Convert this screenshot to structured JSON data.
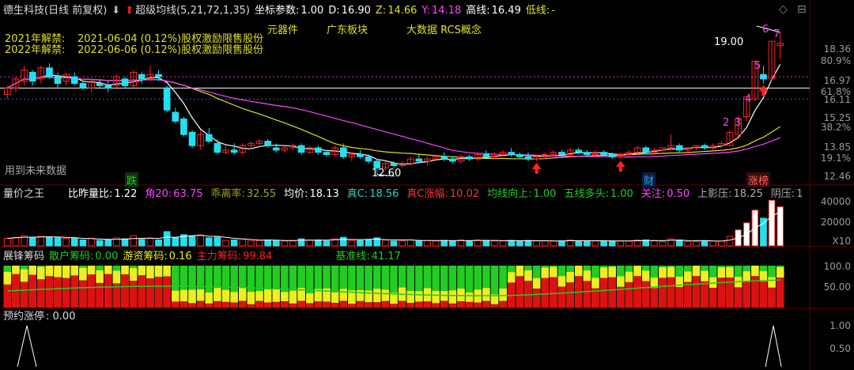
{
  "main": {
    "stock_name": "德生科技(日线 前复权)",
    "indicator": "超级均线(5,21,72,1,35)",
    "coord_label": "坐标参数:",
    "coord_value": "1.00",
    "d_label": "D:",
    "d_value": "16.90",
    "z_label": "Z:",
    "z_value": "14.66",
    "y_label": "Y:",
    "y_value": "14.18",
    "high_label": "高线:",
    "high_value": "16.49",
    "low_label": "低线:",
    "low_value": "-",
    "unlock_2021": "2021年解禁:",
    "unlock_2021_detail": "2021-06-04 (0.12%)股权激励限售股份",
    "unlock_2022": "2022年解禁:",
    "unlock_2022_detail": "2022-06-06 (0.12%)股权激励限售股份",
    "concepts": [
      "元器件",
      "广东板块",
      "大数据 RCS概念"
    ],
    "future_data": "用到未来数据",
    "fall_tag": "跌",
    "finance_tag": "财",
    "limit_tag": "涨榜",
    "high_annot": "19.00",
    "low_annot": "12.60",
    "boards": [
      "2",
      "3",
      "4",
      "5",
      "6",
      "7"
    ],
    "axis": [
      "18.36",
      "80.9%",
      "16.97",
      "61.8%",
      "16.11",
      "15.25",
      "38.2%",
      "13.85",
      "19.1%",
      "12.46"
    ]
  },
  "vol": {
    "title": "量价之王",
    "items": [
      {
        "label": "比昨量比:",
        "value": "1.22",
        "color": "#ffffff"
      },
      {
        "label": "角20:",
        "value": "63.75",
        "color": "#ff44ff"
      },
      {
        "label": "乖离率:",
        "value": "32.55",
        "color": "#a0a020"
      },
      {
        "label": "均价:",
        "value": "18.13",
        "color": "#ffffff"
      },
      {
        "label": "真C:",
        "value": "18.56",
        "color": "#33cccc"
      },
      {
        "label": "真C涨幅:",
        "value": "10.02",
        "color": "#ff3333"
      },
      {
        "label": "均线向上:",
        "value": "1.00",
        "color": "#22cc22"
      },
      {
        "label": "五线多头:",
        "value": "1.00",
        "color": "#22cc22"
      },
      {
        "label": "关注:",
        "value": "0.50",
        "color": "#ff44ff"
      },
      {
        "label": "上影压:",
        "value": "18.25",
        "color": "#aaaaaa"
      },
      {
        "label": "阴压:",
        "value": "1",
        "color": "#aaaaaa"
      }
    ],
    "axis": [
      "40000",
      "20000",
      "X10"
    ]
  },
  "chips": {
    "title": "展锋筹码",
    "retail_label": "散户筹码:",
    "retail_value": "0.00",
    "hot_label": "游资筹码:",
    "hot_value": "0.16",
    "main_label": "主力筹码:",
    "main_value": "99.84",
    "base_label": "基准线:",
    "base_value": "41.17",
    "axis": [
      "100.0",
      "50.00"
    ]
  },
  "limit": {
    "title": "预约涨停",
    "value": ": 0.00",
    "axis": [
      "1.00",
      "0.50"
    ]
  },
  "colors": {
    "up": "#ff2222",
    "down": "#22e0f0",
    "ma1": "#ffffff",
    "ma2": "#e0e020",
    "ma3": "#ff44ff",
    "retail": "#22cc22",
    "hot": "#eeee22",
    "main": "#dd1111"
  },
  "chart_data": {
    "type": "candlestick",
    "bars": 93,
    "ohlc": [
      [
        16.2,
        16.6,
        16.0,
        16.5
      ],
      [
        16.5,
        17.0,
        16.3,
        16.9
      ],
      [
        16.8,
        17.5,
        16.6,
        17.3
      ],
      [
        17.2,
        17.3,
        16.6,
        16.8
      ],
      [
        16.9,
        17.5,
        16.7,
        17.4
      ],
      [
        17.4,
        17.6,
        16.9,
        17.0
      ],
      [
        17.0,
        17.2,
        16.5,
        16.7
      ],
      [
        16.8,
        17.2,
        16.6,
        17.1
      ],
      [
        17.0,
        17.2,
        16.6,
        16.7
      ],
      [
        16.7,
        16.8,
        16.4,
        16.5
      ],
      [
        16.5,
        16.9,
        16.3,
        16.8
      ],
      [
        16.7,
        16.9,
        16.5,
        16.6
      ],
      [
        16.6,
        16.8,
        16.3,
        16.5
      ],
      [
        16.6,
        17.1,
        16.5,
        17.0
      ],
      [
        16.9,
        17.0,
        16.5,
        16.6
      ],
      [
        16.6,
        17.3,
        16.5,
        17.2
      ],
      [
        17.1,
        17.2,
        16.7,
        16.9
      ],
      [
        16.9,
        17.5,
        16.8,
        17.1
      ],
      [
        17.1,
        17.3,
        16.8,
        17.0
      ],
      [
        16.5,
        16.6,
        15.4,
        15.5
      ],
      [
        15.4,
        15.6,
        14.9,
        15.0
      ],
      [
        15.1,
        15.2,
        14.3,
        14.4
      ],
      [
        14.5,
        14.6,
        13.8,
        13.9
      ],
      [
        13.9,
        14.6,
        13.7,
        14.4
      ],
      [
        14.4,
        14.7,
        14.0,
        14.1
      ],
      [
        14.0,
        14.2,
        13.5,
        13.6
      ],
      [
        13.6,
        13.9,
        13.5,
        13.7
      ],
      [
        13.7,
        14.0,
        13.5,
        13.6
      ],
      [
        13.6,
        14.0,
        13.5,
        13.9
      ],
      [
        13.9,
        14.1,
        13.8,
        14.0
      ],
      [
        14.0,
        14.2,
        13.8,
        14.1
      ],
      [
        14.1,
        14.2,
        13.8,
        13.9
      ],
      [
        13.8,
        14.0,
        13.6,
        13.7
      ],
      [
        13.7,
        13.9,
        13.6,
        13.8
      ],
      [
        13.8,
        14.0,
        13.7,
        13.9
      ],
      [
        13.9,
        14.0,
        13.5,
        13.6
      ],
      [
        13.6,
        13.9,
        13.5,
        13.8
      ],
      [
        13.8,
        13.9,
        13.5,
        13.6
      ],
      [
        13.6,
        13.7,
        13.4,
        13.5
      ],
      [
        13.5,
        13.9,
        13.4,
        13.8
      ],
      [
        13.8,
        14.0,
        13.3,
        13.4
      ],
      [
        13.4,
        13.6,
        13.2,
        13.5
      ],
      [
        13.5,
        13.7,
        13.3,
        13.4
      ],
      [
        13.4,
        13.5,
        13.1,
        13.2
      ],
      [
        13.2,
        13.3,
        12.6,
        12.9
      ],
      [
        12.9,
        13.2,
        12.8,
        13.1
      ],
      [
        13.1,
        13.2,
        12.9,
        13.0
      ],
      [
        13.0,
        13.2,
        12.9,
        13.1
      ],
      [
        13.1,
        13.4,
        13.0,
        13.3
      ],
      [
        13.3,
        13.5,
        13.1,
        13.2
      ],
      [
        13.2,
        13.4,
        13.0,
        13.3
      ],
      [
        13.3,
        13.5,
        13.2,
        13.4
      ],
      [
        13.4,
        13.6,
        13.2,
        13.3
      ],
      [
        13.3,
        13.4,
        13.1,
        13.2
      ],
      [
        13.2,
        13.5,
        13.1,
        13.4
      ],
      [
        13.4,
        13.5,
        13.2,
        13.3
      ],
      [
        13.3,
        13.6,
        13.2,
        13.5
      ],
      [
        13.5,
        13.7,
        13.3,
        13.4
      ],
      [
        13.4,
        13.6,
        13.3,
        13.5
      ],
      [
        13.5,
        13.7,
        13.4,
        13.6
      ],
      [
        13.6,
        13.8,
        13.4,
        13.5
      ],
      [
        13.5,
        13.6,
        13.3,
        13.4
      ],
      [
        13.4,
        13.6,
        13.2,
        13.3
      ],
      [
        13.3,
        13.5,
        13.2,
        13.4
      ],
      [
        13.4,
        13.6,
        13.3,
        13.5
      ],
      [
        13.5,
        13.7,
        13.4,
        13.6
      ],
      [
        13.6,
        13.7,
        13.4,
        13.5
      ],
      [
        13.5,
        13.8,
        13.4,
        13.7
      ],
      [
        13.7,
        13.8,
        13.5,
        13.6
      ],
      [
        13.6,
        13.7,
        13.4,
        13.5
      ],
      [
        13.5,
        13.7,
        13.4,
        13.6
      ],
      [
        13.6,
        13.7,
        13.4,
        13.5
      ],
      [
        13.5,
        13.6,
        13.3,
        13.4
      ],
      [
        13.4,
        13.6,
        13.3,
        13.5
      ],
      [
        13.5,
        13.7,
        13.4,
        13.6
      ],
      [
        13.6,
        13.9,
        13.5,
        13.8
      ],
      [
        13.8,
        13.9,
        13.5,
        13.6
      ],
      [
        13.6,
        13.8,
        13.5,
        13.7
      ],
      [
        13.7,
        13.8,
        13.6,
        13.8
      ],
      [
        13.8,
        14.4,
        13.7,
        13.9
      ],
      [
        13.9,
        14.0,
        13.6,
        13.7
      ],
      [
        13.7,
        13.8,
        13.6,
        13.8
      ],
      [
        13.8,
        13.9,
        13.7,
        13.9
      ],
      [
        13.9,
        14.0,
        13.7,
        13.8
      ],
      [
        13.8,
        14.0,
        13.7,
        13.9
      ],
      [
        13.9,
        14.1,
        13.8,
        14.0
      ],
      [
        13.9,
        14.6,
        13.9,
        14.5
      ],
      [
        14.4,
        15.2,
        14.3,
        15.1
      ],
      [
        15.2,
        16.1,
        15.0,
        16.1
      ],
      [
        16.0,
        17.7,
        15.9,
        17.7
      ],
      [
        17.1,
        17.5,
        16.7,
        16.9
      ],
      [
        16.9,
        18.6,
        16.8,
        18.6
      ],
      [
        18.4,
        19.0,
        17.8,
        18.5
      ]
    ]
  }
}
